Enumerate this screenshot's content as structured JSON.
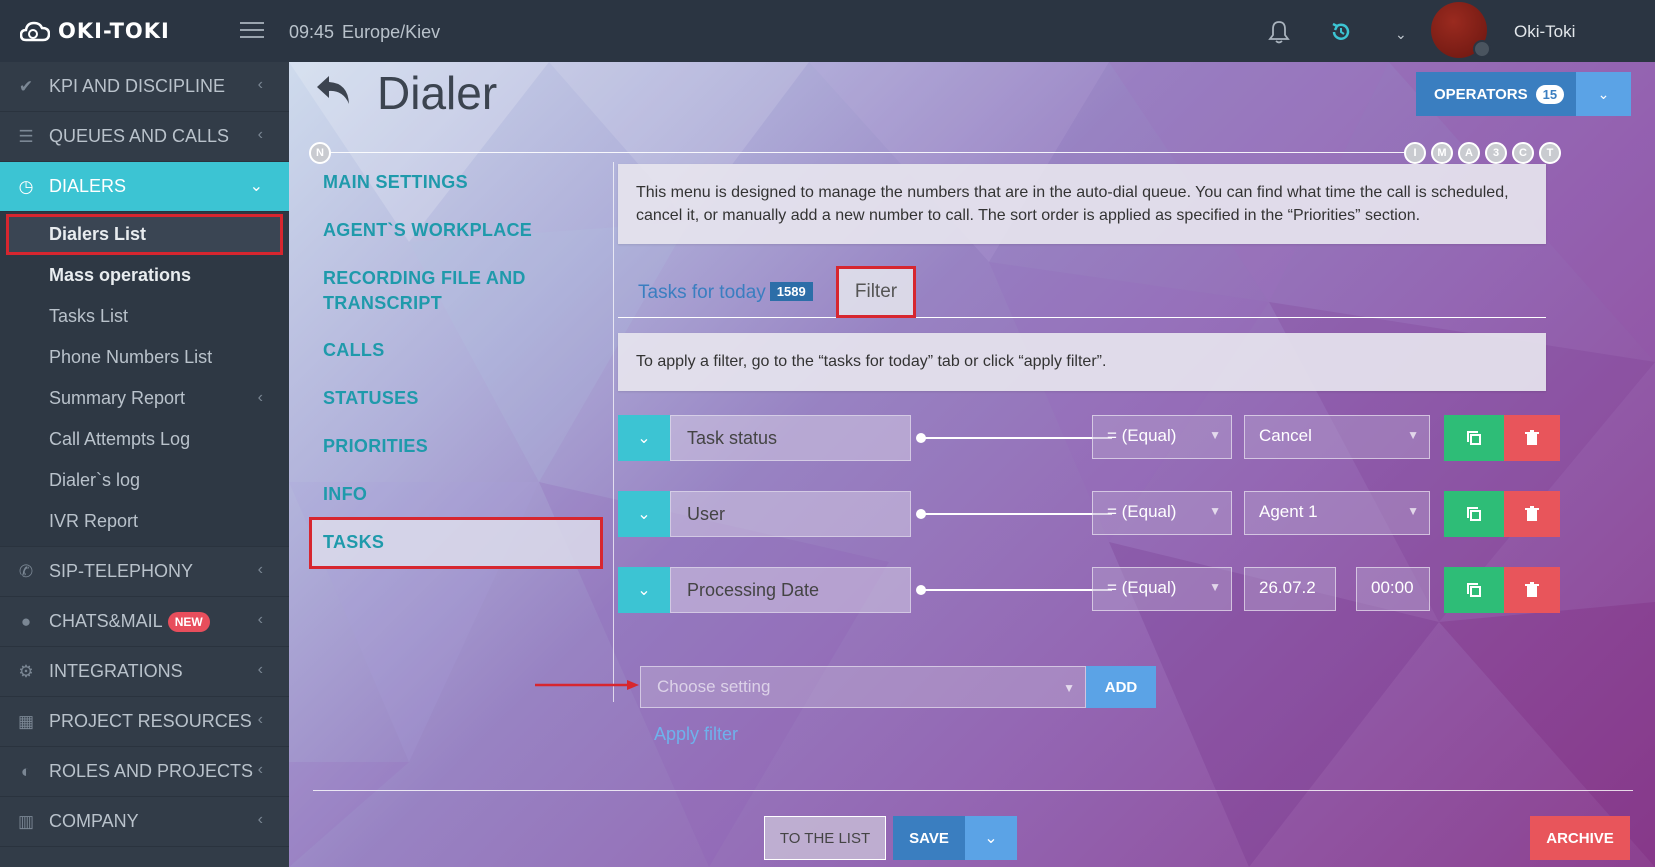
{
  "app": {
    "logo": "OKI-TOKI",
    "time": "09:45",
    "timezone": "Europe/Kiev",
    "user": "Oki-Toki"
  },
  "sidebar": {
    "items": [
      {
        "label": "KPI AND DISCIPLINE",
        "icon": "check-icon"
      },
      {
        "label": "QUEUES AND CALLS",
        "icon": "list-icon"
      },
      {
        "label": "DIALERS",
        "icon": "clock-icon"
      }
    ],
    "sub": [
      {
        "label": "Dialers List"
      },
      {
        "label": "Mass operations"
      },
      {
        "label": "Tasks List"
      },
      {
        "label": "Phone Numbers List"
      },
      {
        "label": "Summary Report"
      },
      {
        "label": "Call Attempts Log"
      },
      {
        "label": "Dialer`s log"
      },
      {
        "label": "IVR Report"
      }
    ],
    "bottom": [
      {
        "label": "SIP-TELEPHONY",
        "icon": "phone-icon"
      },
      {
        "label": "CHATS&MAIL",
        "icon": "chat-icon",
        "badge": "NEW"
      },
      {
        "label": "INTEGRATIONS",
        "icon": "gears-icon"
      },
      {
        "label": "PROJECT RESOURCES",
        "icon": "grid-icon"
      },
      {
        "label": "ROLES AND PROJECTS",
        "icon": "toggle-icon"
      },
      {
        "label": "COMPANY",
        "icon": "bar-chart-icon"
      }
    ]
  },
  "page": {
    "title": "Dialer",
    "operators_label": "OPERATORS",
    "operators_count": "15",
    "timeline_start": "N",
    "timeline_nodes": [
      "I",
      "M",
      "A",
      "3",
      "C",
      "T"
    ]
  },
  "menu": {
    "main_settings": "MAIN SETTINGS",
    "agent_workplace": "AGENT`S WORKPLACE",
    "recording_1": "RECORDING FILE AND",
    "recording_2": "TRANSCRIPT",
    "calls": "CALLS",
    "statuses": "STATUSES",
    "priorities": "PRIORITIES",
    "info": "INFO",
    "tasks": "TASKS"
  },
  "description": "This menu is designed to manage the numbers that are in the auto-dial queue. You can find what time the call is scheduled, cancel it, or manually add a new number to call. The sort order is applied as specified in the “Priorities” section.",
  "tabs": {
    "today": "Tasks for today",
    "today_count": "1589",
    "filter": "Filter"
  },
  "filter_hint": "To apply a filter, go to the “tasks for today” tab or click “apply filter”.",
  "filters": [
    {
      "name": "Task status",
      "op": "= (Equal)",
      "value": "Cancel"
    },
    {
      "name": "User",
      "op": "= (Equal)",
      "value": "Agent 1"
    },
    {
      "name": "Processing Date",
      "op": "= (Equal)",
      "value": "26.07.2",
      "time": "00:00"
    }
  ],
  "choose_placeholder": "Choose setting",
  "add_label": "ADD",
  "apply_filter": "Apply filter",
  "buttons": {
    "to_list": "TO THE LIST",
    "save": "SAVE",
    "archive": "ARCHIVE"
  },
  "colors": {
    "accent": "#3cc4d3",
    "primary": "#3a7ec0",
    "danger": "#e8555b",
    "success": "#2ebd77",
    "highlight": "#d7262f"
  }
}
